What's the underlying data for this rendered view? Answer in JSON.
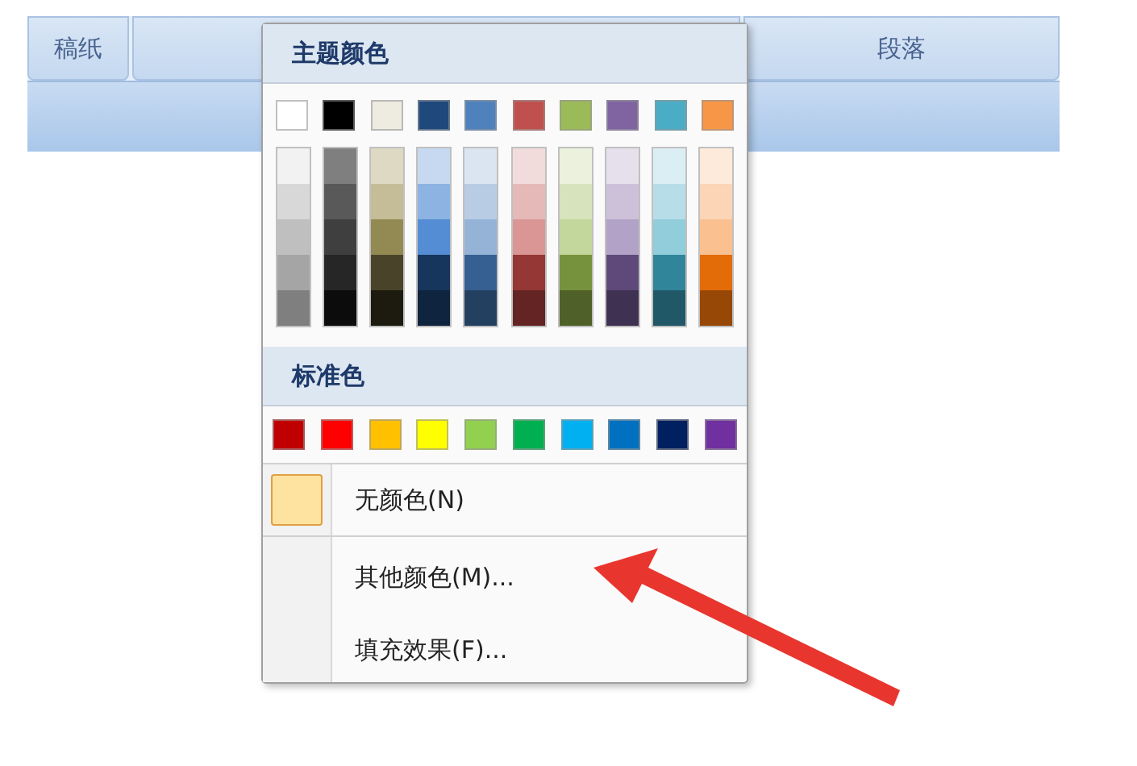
{
  "ribbon": {
    "groups": [
      {
        "kind": "labeled",
        "label": "稿纸"
      },
      {
        "kind": "blank"
      },
      {
        "kind": "labeled",
        "label": "段落"
      }
    ]
  },
  "color_menu": {
    "theme_heading": "主题颜色",
    "theme_colors": [
      {
        "color": "#ffffff",
        "shades": [
          {
            "color": "#f2f2f2"
          },
          {
            "color": "#d8d8d8"
          },
          {
            "color": "#bfbfbf"
          },
          {
            "color": "#a5a5a5"
          },
          {
            "color": "#7f7f7f"
          }
        ]
      },
      {
        "color": "#000000",
        "shades": [
          {
            "color": "#7f7f7f"
          },
          {
            "color": "#595959"
          },
          {
            "color": "#3f3f3f"
          },
          {
            "color": "#262626"
          },
          {
            "color": "#0c0c0c"
          }
        ]
      },
      {
        "color": "#eeece1",
        "shades": [
          {
            "color": "#ddd9c3"
          },
          {
            "color": "#c4bd97"
          },
          {
            "color": "#938953"
          },
          {
            "color": "#494429"
          },
          {
            "color": "#1d1b10"
          }
        ]
      },
      {
        "color": "#1f497d",
        "shades": [
          {
            "color": "#c6d9f0"
          },
          {
            "color": "#8db3e2"
          },
          {
            "color": "#548dd4"
          },
          {
            "color": "#17365d"
          },
          {
            "color": "#0f243e"
          }
        ]
      },
      {
        "color": "#4f81bd",
        "shades": [
          {
            "color": "#dbe5f1"
          },
          {
            "color": "#b8cce4"
          },
          {
            "color": "#95b3d7"
          },
          {
            "color": "#366092"
          },
          {
            "color": "#244061"
          }
        ]
      },
      {
        "color": "#c0504d",
        "shades": [
          {
            "color": "#f2dcdb"
          },
          {
            "color": "#e5b9b7"
          },
          {
            "color": "#d99694"
          },
          {
            "color": "#953734"
          },
          {
            "color": "#632423"
          }
        ]
      },
      {
        "color": "#9bbb59",
        "shades": [
          {
            "color": "#ebf1dd"
          },
          {
            "color": "#d7e3bc"
          },
          {
            "color": "#c3d69b"
          },
          {
            "color": "#76923c"
          },
          {
            "color": "#4f6128"
          }
        ]
      },
      {
        "color": "#8064a2",
        "shades": [
          {
            "color": "#e5e0ec"
          },
          {
            "color": "#ccc1d9"
          },
          {
            "color": "#b2a2c7"
          },
          {
            "color": "#5f497a"
          },
          {
            "color": "#3f3151"
          }
        ]
      },
      {
        "color": "#4bacc6",
        "shades": [
          {
            "color": "#dbeef3"
          },
          {
            "color": "#b7dde8"
          },
          {
            "color": "#92cddc"
          },
          {
            "color": "#31859b"
          },
          {
            "color": "#205867"
          }
        ]
      },
      {
        "color": "#f79646",
        "shades": [
          {
            "color": "#fdeada"
          },
          {
            "color": "#fbd5b5"
          },
          {
            "color": "#fac08f"
          },
          {
            "color": "#e36c09"
          },
          {
            "color": "#974806"
          }
        ]
      }
    ],
    "standard_heading": "标准色",
    "standard_colors": [
      {
        "color": "#c00000"
      },
      {
        "color": "#ff0000"
      },
      {
        "color": "#ffc000"
      },
      {
        "color": "#ffff00"
      },
      {
        "color": "#92d050"
      },
      {
        "color": "#00b050"
      },
      {
        "color": "#00b0f0"
      },
      {
        "color": "#0070c0"
      },
      {
        "color": "#002060"
      },
      {
        "color": "#7030a0"
      }
    ],
    "items": [
      {
        "label": "无颜色(N)",
        "kind": "swatch"
      },
      {
        "label": "其他颜色(M)...",
        "kind": "plain"
      },
      {
        "label": "填充效果(F)...",
        "kind": "plain"
      }
    ]
  }
}
